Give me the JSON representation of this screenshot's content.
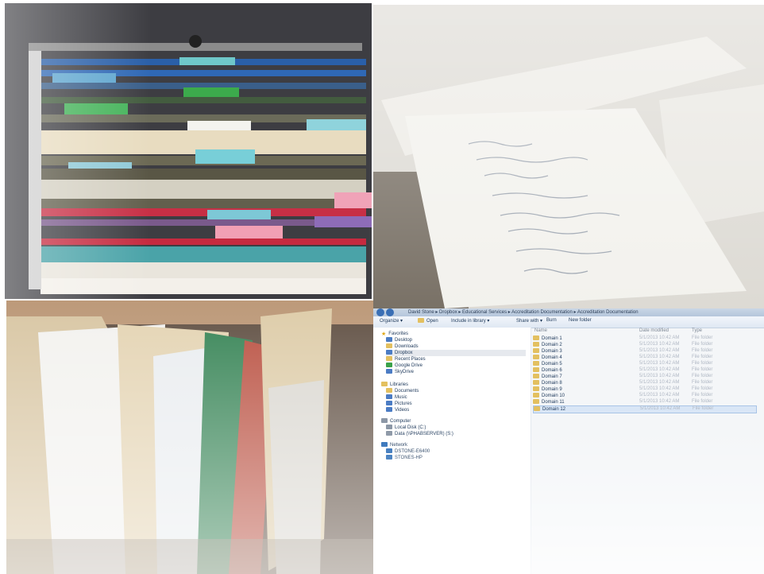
{
  "photos": {
    "top_left": "hanging-file-drawer-photo",
    "top_right": "handwritten-notes-photo",
    "bottom_left": "manila-folders-photo"
  },
  "explorer": {
    "breadcrumb": "David Stone ▸ Dropbox ▸ Educational Services ▸ Accreditation Documentation ▸ Accreditation Documentation",
    "toolbar": {
      "organize": "Organize ▾",
      "open": "Open",
      "include": "Include in library ▾",
      "share": "Share with ▾",
      "burn": "Burn",
      "new_folder": "New folder"
    },
    "columns": {
      "name": "Name",
      "date": "Date modified",
      "type": "Type"
    },
    "nav": {
      "favorites": "Favorites",
      "desktop": "Desktop",
      "downloads": "Downloads",
      "dropbox": "Dropbox",
      "recent": "Recent Places",
      "gdrive": "Google Drive",
      "skydrive": "SkyDrive",
      "libraries": "Libraries",
      "documents": "Documents",
      "music": "Music",
      "pictures": "Pictures",
      "videos": "Videos",
      "computer": "Computer",
      "local_disk": "Local Disk (C:)",
      "data_drive": "Data (\\\\PHABSERVER) (S:)",
      "network": "Network",
      "net1": "DSTONE-E6400",
      "net2": "STONES-HP"
    },
    "rows": [
      {
        "name": "Domain 1",
        "date": "5/1/2013 10:42 AM",
        "type": "File folder"
      },
      {
        "name": "Domain 2",
        "date": "5/1/2013 10:42 AM",
        "type": "File folder"
      },
      {
        "name": "Domain 3",
        "date": "5/1/2013 10:42 AM",
        "type": "File folder"
      },
      {
        "name": "Domain 4",
        "date": "5/1/2013 10:42 AM",
        "type": "File folder"
      },
      {
        "name": "Domain 5",
        "date": "5/1/2013 10:42 AM",
        "type": "File folder"
      },
      {
        "name": "Domain 6",
        "date": "5/1/2013 10:42 AM",
        "type": "File folder"
      },
      {
        "name": "Domain 7",
        "date": "5/1/2013 10:42 AM",
        "type": "File folder"
      },
      {
        "name": "Domain 8",
        "date": "5/1/2013 10:42 AM",
        "type": "File folder"
      },
      {
        "name": "Domain 9",
        "date": "5/1/2013 10:42 AM",
        "type": "File folder"
      },
      {
        "name": "Domain 10",
        "date": "5/1/2013 10:42 AM",
        "type": "File folder"
      },
      {
        "name": "Domain 11",
        "date": "5/1/2013 10:42 AM",
        "type": "File folder"
      },
      {
        "name": "Domain 12",
        "date": "5/1/2013 10:42 AM",
        "type": "File folder"
      }
    ]
  }
}
